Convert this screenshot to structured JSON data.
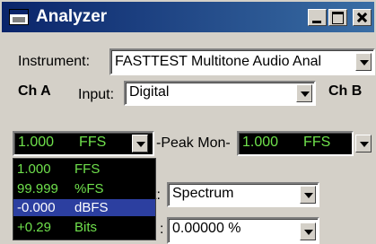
{
  "window": {
    "title": "Analyzer"
  },
  "instrument": {
    "label": "Instrument:",
    "value": "FASTTEST Multitone Audio Anal"
  },
  "channel_a": {
    "label": "Ch A"
  },
  "channel_b": {
    "label": "Ch B"
  },
  "input": {
    "label": "Input:",
    "value": "Digital"
  },
  "level_selector": {
    "value": "1.000",
    "unit": "FFS"
  },
  "peak_monitor": {
    "label": "-Peak Mon-",
    "value": "1.000",
    "unit": "FFS"
  },
  "dropdown_menu": {
    "items": [
      {
        "value": "1.000",
        "unit": "FFS",
        "selected": false
      },
      {
        "value": "99.999",
        "unit": "%FS",
        "selected": false
      },
      {
        "value": "-0.000",
        "unit": "dBFS",
        "selected": true
      },
      {
        "value": "+0.29",
        "unit": "Bits",
        "selected": false
      }
    ]
  },
  "measurement": {
    "label_fragment": "t:",
    "value": "Spectrum"
  },
  "readout": {
    "label_fragment": ":",
    "value": "0.00000 %"
  },
  "colors": {
    "meter_green": "#6fe04c",
    "selection": "#2c3fa0",
    "titlebar": "#0a246a"
  }
}
